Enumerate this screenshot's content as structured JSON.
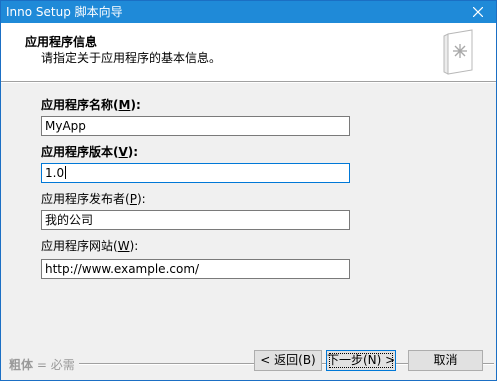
{
  "window": {
    "title": "Inno Setup 脚本向导",
    "close_glyph": "✕"
  },
  "header": {
    "title": "应用程序信息",
    "subtitle": "请指定关于应用程序的基本信息。",
    "icon": "wizard-page-icon"
  },
  "form": {
    "app_name": {
      "label": "应用程序名称(",
      "mnemonic": "M",
      "label_end": "):",
      "value": "MyApp"
    },
    "app_version": {
      "label": "应用程序版本(",
      "mnemonic": "V",
      "label_end": "):",
      "value": "1.0"
    },
    "app_publisher": {
      "label": "应用程序发布者(",
      "mnemonic": "P",
      "label_end": "):",
      "value": "我的公司"
    },
    "app_website": {
      "label": "应用程序网站(",
      "mnemonic": "W",
      "label_end": "):",
      "value": "http://www.example.com/"
    }
  },
  "footer": {
    "legend_bold": "粗体",
    "legend_rest": " = 必需",
    "back_button": "< 返回(B)",
    "next_button": "下一步(N) >",
    "cancel_button": "取消"
  },
  "colors": {
    "titlebar": "#1f8ad8",
    "focus_border": "#0078d7",
    "dialog_bg": "#f0f0f0"
  }
}
